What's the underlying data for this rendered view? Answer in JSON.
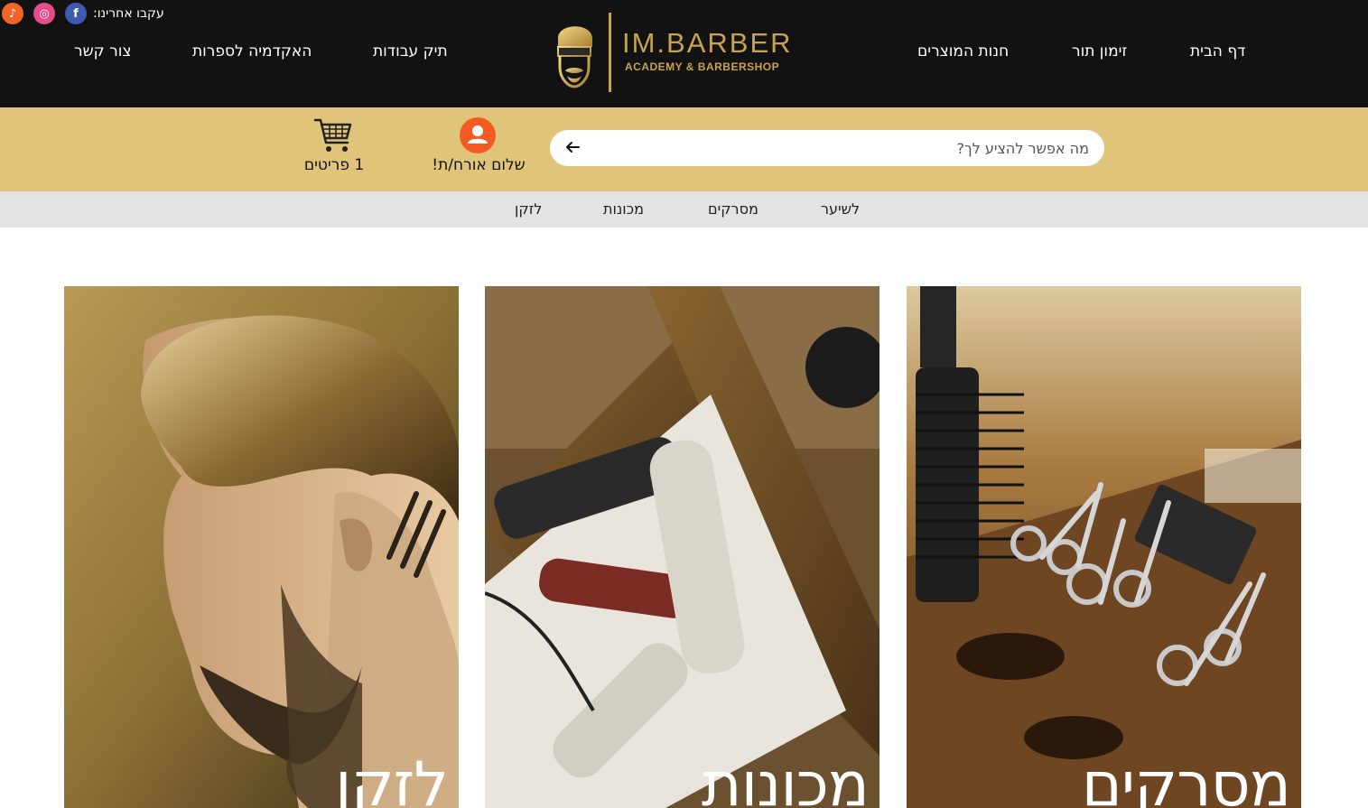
{
  "header": {
    "follow_label": "עקבו אחרינו:",
    "social": [
      {
        "name": "tiktok",
        "icon": "tiktok-icon",
        "glyph": "♪",
        "color": "#f0642a"
      },
      {
        "name": "instagram",
        "icon": "instagram-icon",
        "glyph": "◎",
        "color": "#e64c8a"
      },
      {
        "name": "facebook",
        "icon": "facebook-icon",
        "glyph": "f",
        "color": "#3b5ab0"
      }
    ],
    "nav": {
      "home": "דף הבית",
      "booking": "זימון תור",
      "shop": "חנות המוצרים",
      "portfolio": "תיק עבודות",
      "academy": "האקדמיה לספרות",
      "contact": "צור קשר"
    },
    "logo": {
      "title": "IM.BARBER",
      "subtitle": "ACADEMY & BARBERSHOP"
    }
  },
  "search": {
    "placeholder": "מה אפשר להציע לך?",
    "value": ""
  },
  "account": {
    "greeting": "שלום אורח/ת!",
    "cart_count": "1 פריטים"
  },
  "categories": {
    "hair": "לשיער",
    "combs": "מסרקים",
    "machines": "מכונות",
    "beard": "לזקן"
  },
  "tiles": [
    {
      "label": "לזקן"
    },
    {
      "label": "מכונות"
    },
    {
      "label": "מסרקים"
    }
  ],
  "colors": {
    "header_bg": "#121212",
    "gold": "#c9a24e",
    "search_bar_bg": "#dfc479",
    "category_bar_bg": "#e3e3e3",
    "user_avatar": "#f55a23"
  }
}
